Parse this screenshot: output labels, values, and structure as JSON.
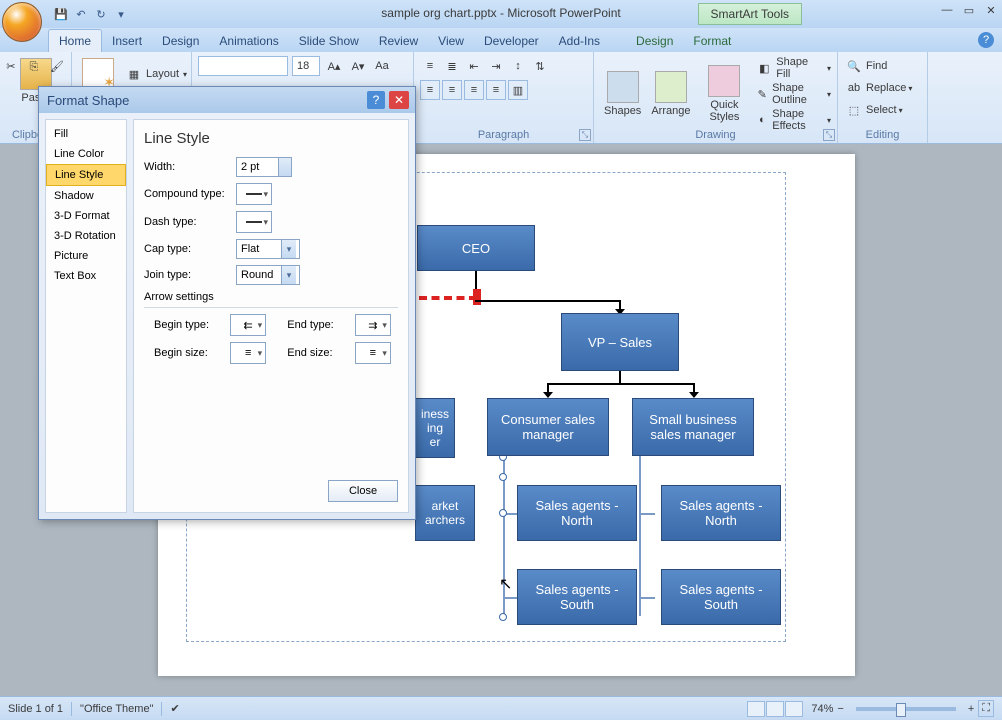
{
  "app": {
    "title": "sample org chart.pptx - Microsoft PowerPoint",
    "contextual_title": "SmartArt Tools"
  },
  "ribbon_tabs": [
    "Home",
    "Insert",
    "Design",
    "Animations",
    "Slide Show",
    "Review",
    "View",
    "Developer",
    "Add-Ins"
  ],
  "ribbon_tabs_contextual": [
    "Design",
    "Format"
  ],
  "ribbon": {
    "clipboard": {
      "label": "Clipboard",
      "paste": "Paste"
    },
    "slides": {
      "layout": "Layout"
    },
    "font": {
      "size": "18"
    },
    "paragraph": {
      "label": "Paragraph"
    },
    "drawing": {
      "label": "Drawing",
      "shapes": "Shapes",
      "arrange": "Arrange",
      "quick": "Quick Styles",
      "fill": "Shape Fill",
      "outline": "Shape Outline",
      "effects": "Shape Effects"
    },
    "editing": {
      "label": "Editing",
      "find": "Find",
      "replace": "Replace",
      "select": "Select"
    }
  },
  "dialog": {
    "title": "Format Shape",
    "nav": [
      "Fill",
      "Line Color",
      "Line Style",
      "Shadow",
      "3-D Format",
      "3-D Rotation",
      "Picture",
      "Text Box"
    ],
    "panel_title": "Line Style",
    "width_label": "Width:",
    "width_value": "2 pt",
    "compound_label": "Compound type:",
    "dash_label": "Dash type:",
    "cap_label": "Cap type:",
    "cap_value": "Flat",
    "join_label": "Join type:",
    "join_value": "Round",
    "arrow_section": "Arrow settings",
    "begin_type": "Begin type:",
    "end_type": "End type:",
    "begin_size": "Begin size:",
    "end_size": "End size:",
    "close": "Close"
  },
  "org": {
    "ceo": "CEO",
    "vp_sales": "VP – Sales",
    "biz_frag": "iness\ning\ner",
    "consumer": "Consumer sales manager",
    "small_biz": "Small business sales manager",
    "market_frag": "arket\narchers",
    "agents_n1": "Sales agents - North",
    "agents_n2": "Sales agents - North",
    "agents_s1": "Sales agents - South",
    "agents_s2": "Sales agents - South"
  },
  "status": {
    "slide": "Slide 1 of 1",
    "theme": "\"Office Theme\"",
    "zoom": "74%"
  }
}
